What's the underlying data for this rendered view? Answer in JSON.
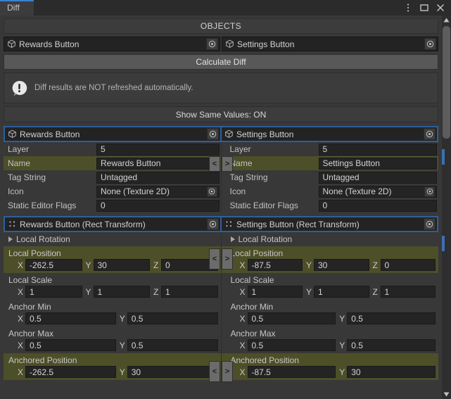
{
  "window": {
    "tab_label": "Diff",
    "controls": {
      "menu": "kebab-menu",
      "maximize": "maximize",
      "close": "close"
    }
  },
  "objects_section": {
    "header": "OBJECTS",
    "left_object": "Rewards Button",
    "right_object": "Settings Button",
    "calculate_button": "Calculate Diff",
    "warning_text": "Diff results are NOT refreshed automatically.",
    "toggle_button": "Show Same Values: ON"
  },
  "gameobject_section": {
    "left_header": "Rewards Button",
    "right_header": "Settings Button",
    "rows": [
      {
        "label": "Layer",
        "left": "5",
        "right": "5",
        "diff": false,
        "picker": false
      },
      {
        "label": "Name",
        "left": "Rewards Button",
        "right": "Settings Button",
        "diff": true,
        "picker": false
      },
      {
        "label": "Tag String",
        "left": "Untagged",
        "right": "Untagged",
        "diff": false,
        "picker": false
      },
      {
        "label": "Icon",
        "left": "None (Texture 2D)",
        "right": "None (Texture 2D)",
        "diff": false,
        "picker": true
      },
      {
        "label": "Static Editor Flags",
        "left": "0",
        "right": "0",
        "diff": false,
        "picker": false
      }
    ]
  },
  "recttransform_section": {
    "left_header": "Rewards Button (Rect Transform)",
    "right_header": "Settings Button (Rect Transform)",
    "foldout": {
      "label": "Local Rotation"
    },
    "vectors": [
      {
        "label": "Local Position",
        "diff": true,
        "axes": [
          "X",
          "Y",
          "Z"
        ],
        "left": [
          "-262.5",
          "30",
          "0"
        ],
        "right": [
          "-87.5",
          "30",
          "0"
        ]
      },
      {
        "label": "Local Scale",
        "diff": false,
        "axes": [
          "X",
          "Y",
          "Z"
        ],
        "left": [
          "1",
          "1",
          "1"
        ],
        "right": [
          "1",
          "1",
          "1"
        ]
      },
      {
        "label": "Anchor Min",
        "diff": false,
        "axes": [
          "X",
          "Y"
        ],
        "left": [
          "0.5",
          "0.5"
        ],
        "right": [
          "0.5",
          "0.5"
        ]
      },
      {
        "label": "Anchor Max",
        "diff": false,
        "axes": [
          "X",
          "Y"
        ],
        "left": [
          "0.5",
          "0.5"
        ],
        "right": [
          "0.5",
          "0.5"
        ]
      },
      {
        "label": "Anchored Position",
        "diff": true,
        "axes": [
          "X",
          "Y"
        ],
        "left": [
          "-262.5",
          "30"
        ],
        "right": [
          "-87.5",
          "30"
        ]
      }
    ]
  },
  "copy_buttons": {
    "left": "<",
    "right": ">"
  },
  "colors": {
    "diff_highlight": "#4d4f28",
    "selection_border": "#2c5f9e",
    "tab_accent": "#3b7fd4",
    "panel_bg": "#383838",
    "field_bg": "#242424"
  }
}
